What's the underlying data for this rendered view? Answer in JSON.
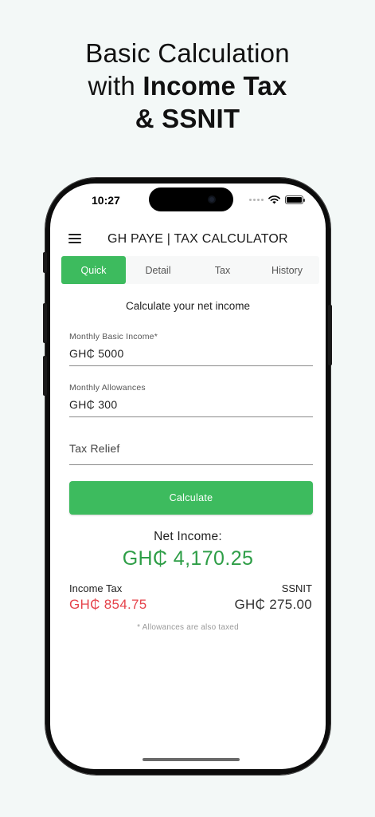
{
  "headline": {
    "line1": "Basic Calculation",
    "line2_prefix": "with ",
    "line2_bold": "Income Tax",
    "line3": "& SSNIT"
  },
  "status_bar": {
    "time": "10:27",
    "icons": [
      "signal-dots-icon",
      "wifi-icon",
      "battery-icon"
    ]
  },
  "app_bar": {
    "menu_icon": "menu-icon",
    "title": "GH PAYE | TAX CALCULATOR"
  },
  "tabs": [
    {
      "label": "Quick",
      "active": true
    },
    {
      "label": "Detail",
      "active": false
    },
    {
      "label": "Tax",
      "active": false
    },
    {
      "label": "History",
      "active": false
    }
  ],
  "form": {
    "subtitle": "Calculate your net income",
    "basic_income": {
      "label": "Monthly Basic Income*",
      "value": "GH₵ 5000"
    },
    "allowances": {
      "label": "Monthly Allowances",
      "value": "GH₵ 300"
    },
    "tax_relief": {
      "placeholder": "Tax Relief",
      "value": ""
    },
    "calculate_label": "Calculate"
  },
  "results": {
    "net_label": "Net Income:",
    "net_value": "GH₵ 4,170.25",
    "income_tax_label": "Income Tax",
    "income_tax_value": "GH₵ 854.75",
    "ssnit_label": "SSNIT",
    "ssnit_value": "GH₵ 275.00",
    "note": "* Allowances are also taxed"
  },
  "colors": {
    "accent": "#3dbb5e",
    "net_income": "#2e9e47",
    "income_tax": "#e5434b",
    "background": "#f3f8f7"
  }
}
